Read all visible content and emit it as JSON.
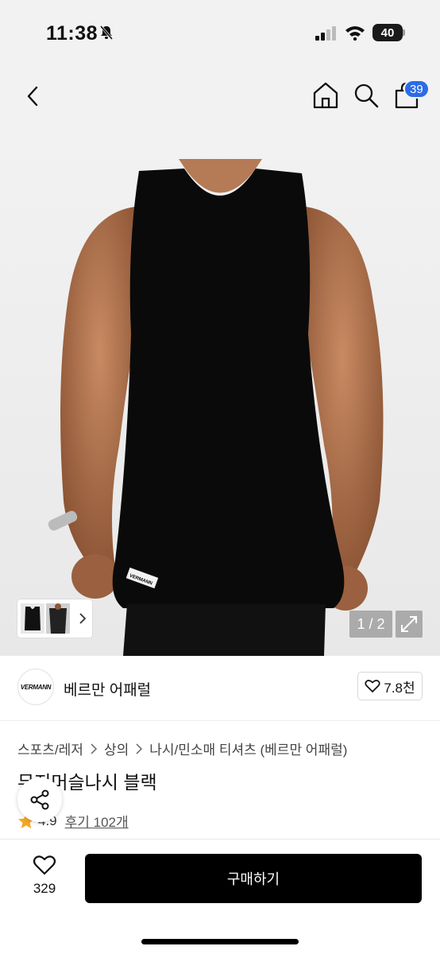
{
  "status_bar": {
    "time": "11:38",
    "battery": "40"
  },
  "header": {
    "cart_count": "39"
  },
  "gallery": {
    "page_indicator": "1 / 2",
    "tank_logo_text": "VERMANN"
  },
  "brand": {
    "logo_text": "VERMANN",
    "name": "베르만 어패럴",
    "likes": "7.8천"
  },
  "breadcrumb": [
    "스포츠/레저",
    "상의",
    "나시/민소매 티셔츠 (베르만 어패럴)"
  ],
  "product": {
    "title": "무지머슬나시 블랙",
    "rating": "4.9",
    "reviews": "후기 102개"
  },
  "bottom_bar": {
    "wish_count": "329",
    "buy_label": "구매하기"
  },
  "colors": {
    "accent_badge": "#2c6be8",
    "buy_button": "#000000",
    "star": "#f5a623"
  }
}
